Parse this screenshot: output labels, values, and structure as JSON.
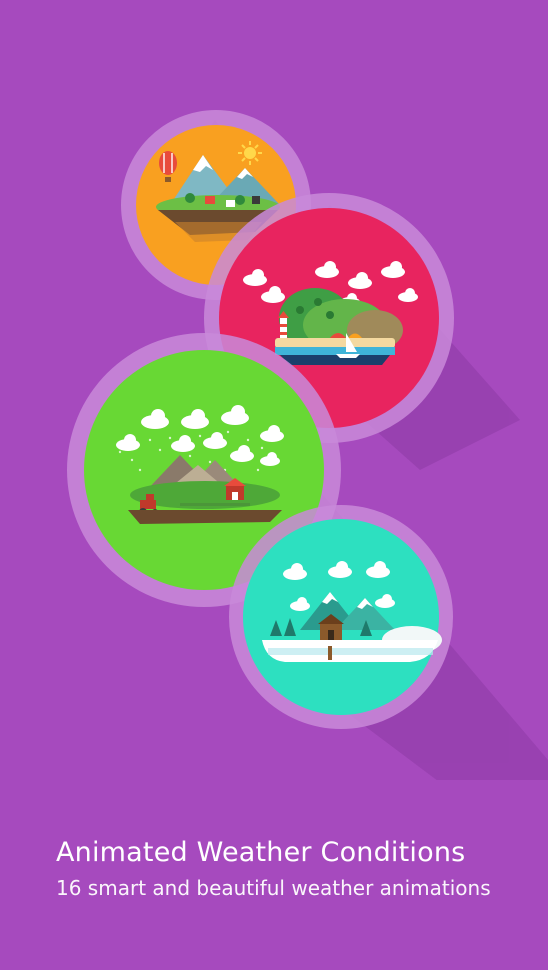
{
  "onboarding": {
    "title": "Animated Weather Conditions",
    "subtitle": "16 smart and beautiful weather animations"
  },
  "scenes": [
    {
      "name": "sunny-mountains",
      "weather": "sunny",
      "color": "#f9a020"
    },
    {
      "name": "cloudy-beach",
      "weather": "cloudy",
      "color": "#e8245f"
    },
    {
      "name": "rainy-farm",
      "weather": "rain",
      "color": "#68d834"
    },
    {
      "name": "snowy-lake",
      "weather": "snow",
      "color": "#2de0c0"
    }
  ],
  "colors": {
    "background": "#a64abe",
    "ring": "#c98ad9"
  }
}
